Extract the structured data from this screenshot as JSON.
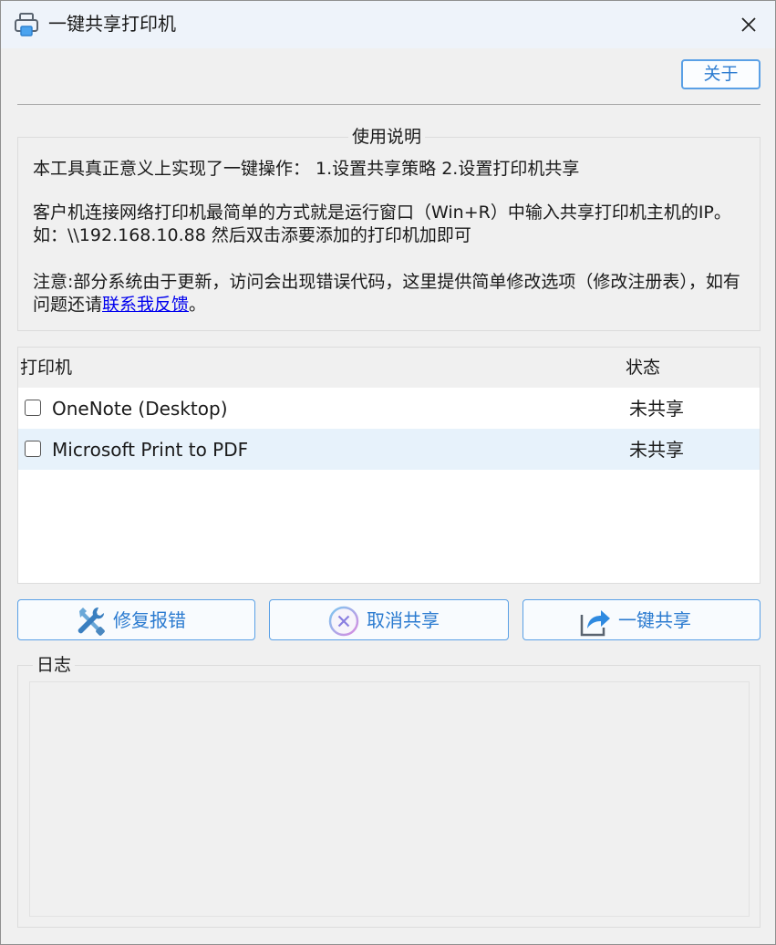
{
  "window": {
    "title": "一键共享打印机",
    "icon": "printer-icon",
    "close_icon": "close-icon"
  },
  "toolbar": {
    "about_label": "关于"
  },
  "usage": {
    "title": "使用说明",
    "line1": "本工具真正意义上实现了一键操作： 1.设置共享策略 2.设置打印机共享",
    "line2": "客户机连接网络打印机最简单的方式就是运行窗口（Win+R）中输入共享打印机主机的IP。如：\\\\192.168.10.88 然后双击添要添加的打印机加即可",
    "line3_prefix": "注意:部分系统由于更新，访问会出现错误代码，这里提供简单修改选项（修改注册表），如有问题还请",
    "line3_link": "联系我反馈",
    "line3_suffix": "。"
  },
  "printer_list": {
    "header_printer": "打印机",
    "header_status": "状态",
    "rows": [
      {
        "name": "OneNote (Desktop)",
        "status": "未共享",
        "checked": false
      },
      {
        "name": "Microsoft Print to PDF",
        "status": "未共享",
        "checked": false
      }
    ]
  },
  "actions": {
    "repair_label": "修复报错",
    "repair_icon": "wrench-screwdriver-icon",
    "cancel_label": "取消共享",
    "cancel_icon": "cancel-circle-icon",
    "share_label": "一键共享",
    "share_icon": "share-arrow-icon"
  },
  "log": {
    "title": "日志",
    "content": ""
  },
  "colors": {
    "accent": "#2b7bd0",
    "button_border": "#5aa0e6",
    "row_alt": "#e7f2fb"
  }
}
